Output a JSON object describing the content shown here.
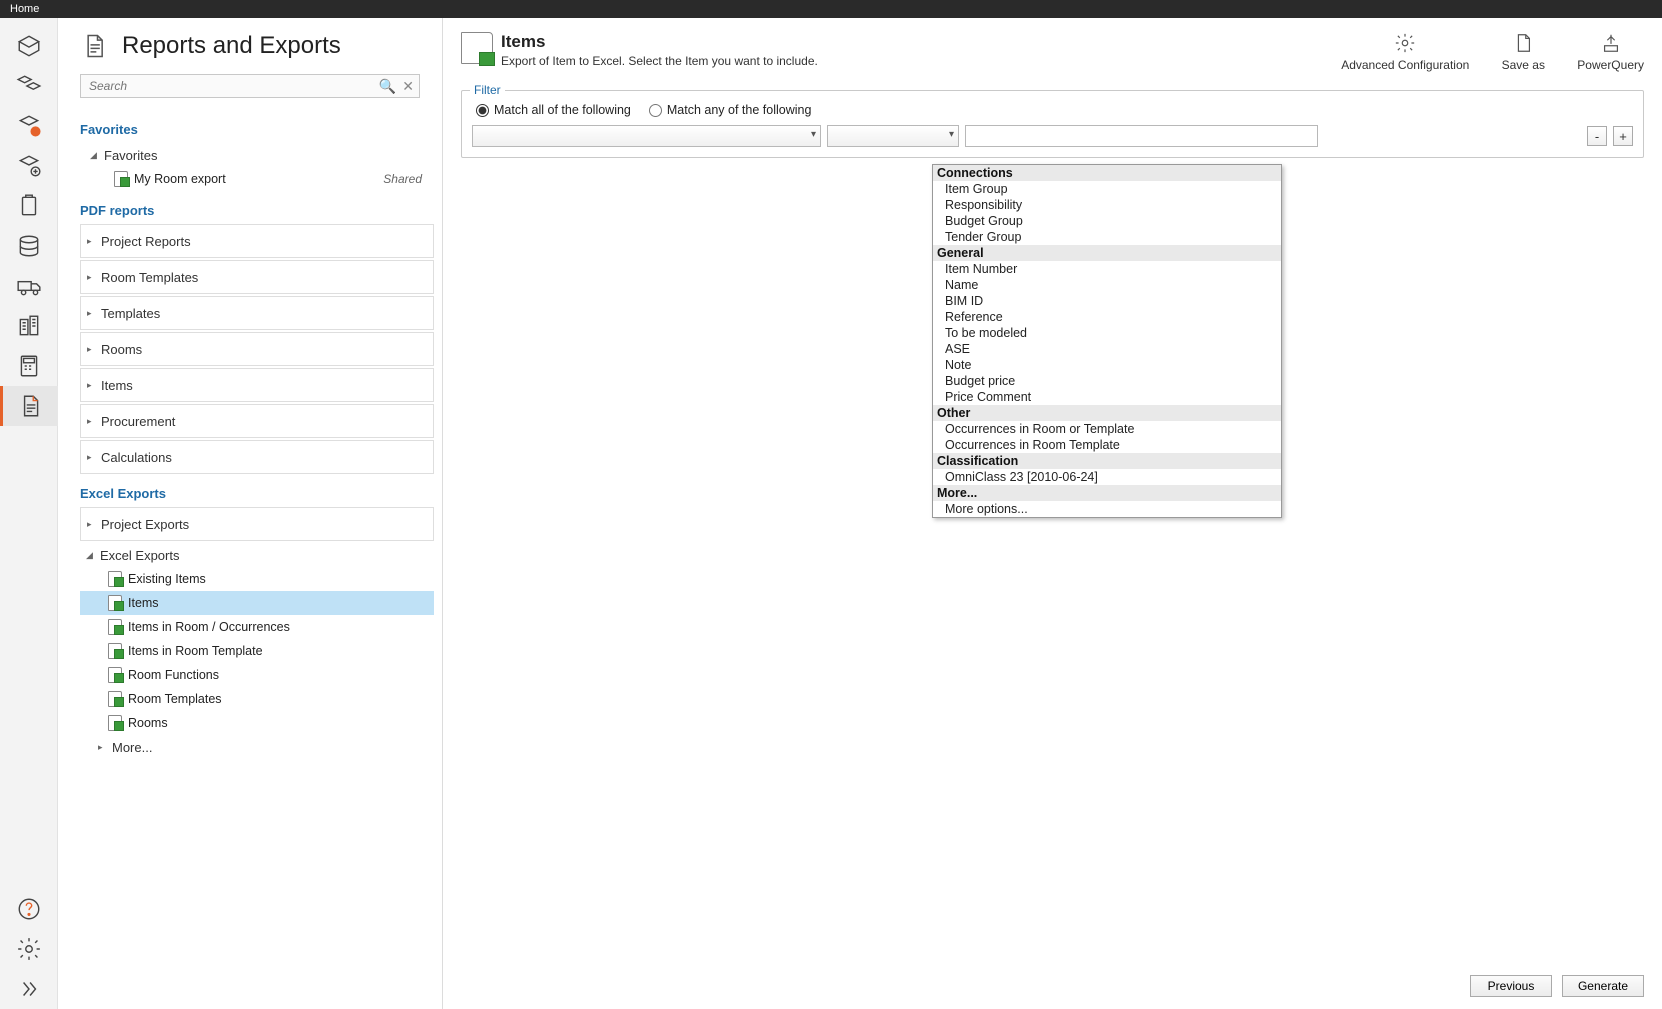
{
  "topbar": {
    "home": "Home"
  },
  "leftpanel": {
    "title": "Reports and Exports",
    "search_placeholder": "Search",
    "sections": {
      "favorites": {
        "title": "Favorites",
        "group": "Favorites",
        "items": [
          {
            "label": "My Room export",
            "shared": "Shared"
          }
        ]
      },
      "pdf": {
        "title": "PDF reports",
        "groups": [
          "Project Reports",
          "Room Templates",
          "Templates",
          "Rooms",
          "Items",
          "Procurement",
          "Calculations"
        ]
      },
      "excel": {
        "title": "Excel Exports",
        "groups": [
          {
            "label": "Project Exports",
            "open": false
          },
          {
            "label": "Excel Exports",
            "open": true,
            "items": [
              "Existing Items",
              "Items",
              "Items in Room / Occurrences",
              "Items in Room Template",
              "Room Functions",
              "Room Templates",
              "Rooms"
            ],
            "selected": "Items"
          }
        ],
        "more": "More..."
      }
    }
  },
  "rightpanel": {
    "title": "Items",
    "subtitle": "Export of Item to Excel. Select the Item you want to include.",
    "actions": {
      "advanced": "Advanced Configuration",
      "saveas": "Save as",
      "powerquery": "PowerQuery"
    },
    "filter": {
      "legend": "Filter",
      "match_all": "Match all of the following",
      "match_any": "Match any of the following",
      "minus": "-",
      "plus": "+"
    },
    "dropdown": {
      "groups": [
        {
          "name": "Connections",
          "items": [
            "Item Group",
            "Responsibility",
            "Budget Group",
            "Tender Group"
          ]
        },
        {
          "name": "General",
          "items": [
            "Item Number",
            "Name",
            "BIM ID",
            "Reference",
            "To be modeled",
            "ASE",
            "Note",
            "Budget price",
            "Price Comment"
          ]
        },
        {
          "name": "Other",
          "items": [
            "Occurrences in Room or Template",
            "Occurrences in Room Template"
          ]
        },
        {
          "name": "Classification",
          "items": [
            "OmniClass 23 [2010-06-24]"
          ]
        },
        {
          "name": "More...",
          "items": [
            "More options..."
          ]
        }
      ]
    },
    "footer": {
      "previous": "Previous",
      "generate": "Generate"
    }
  }
}
